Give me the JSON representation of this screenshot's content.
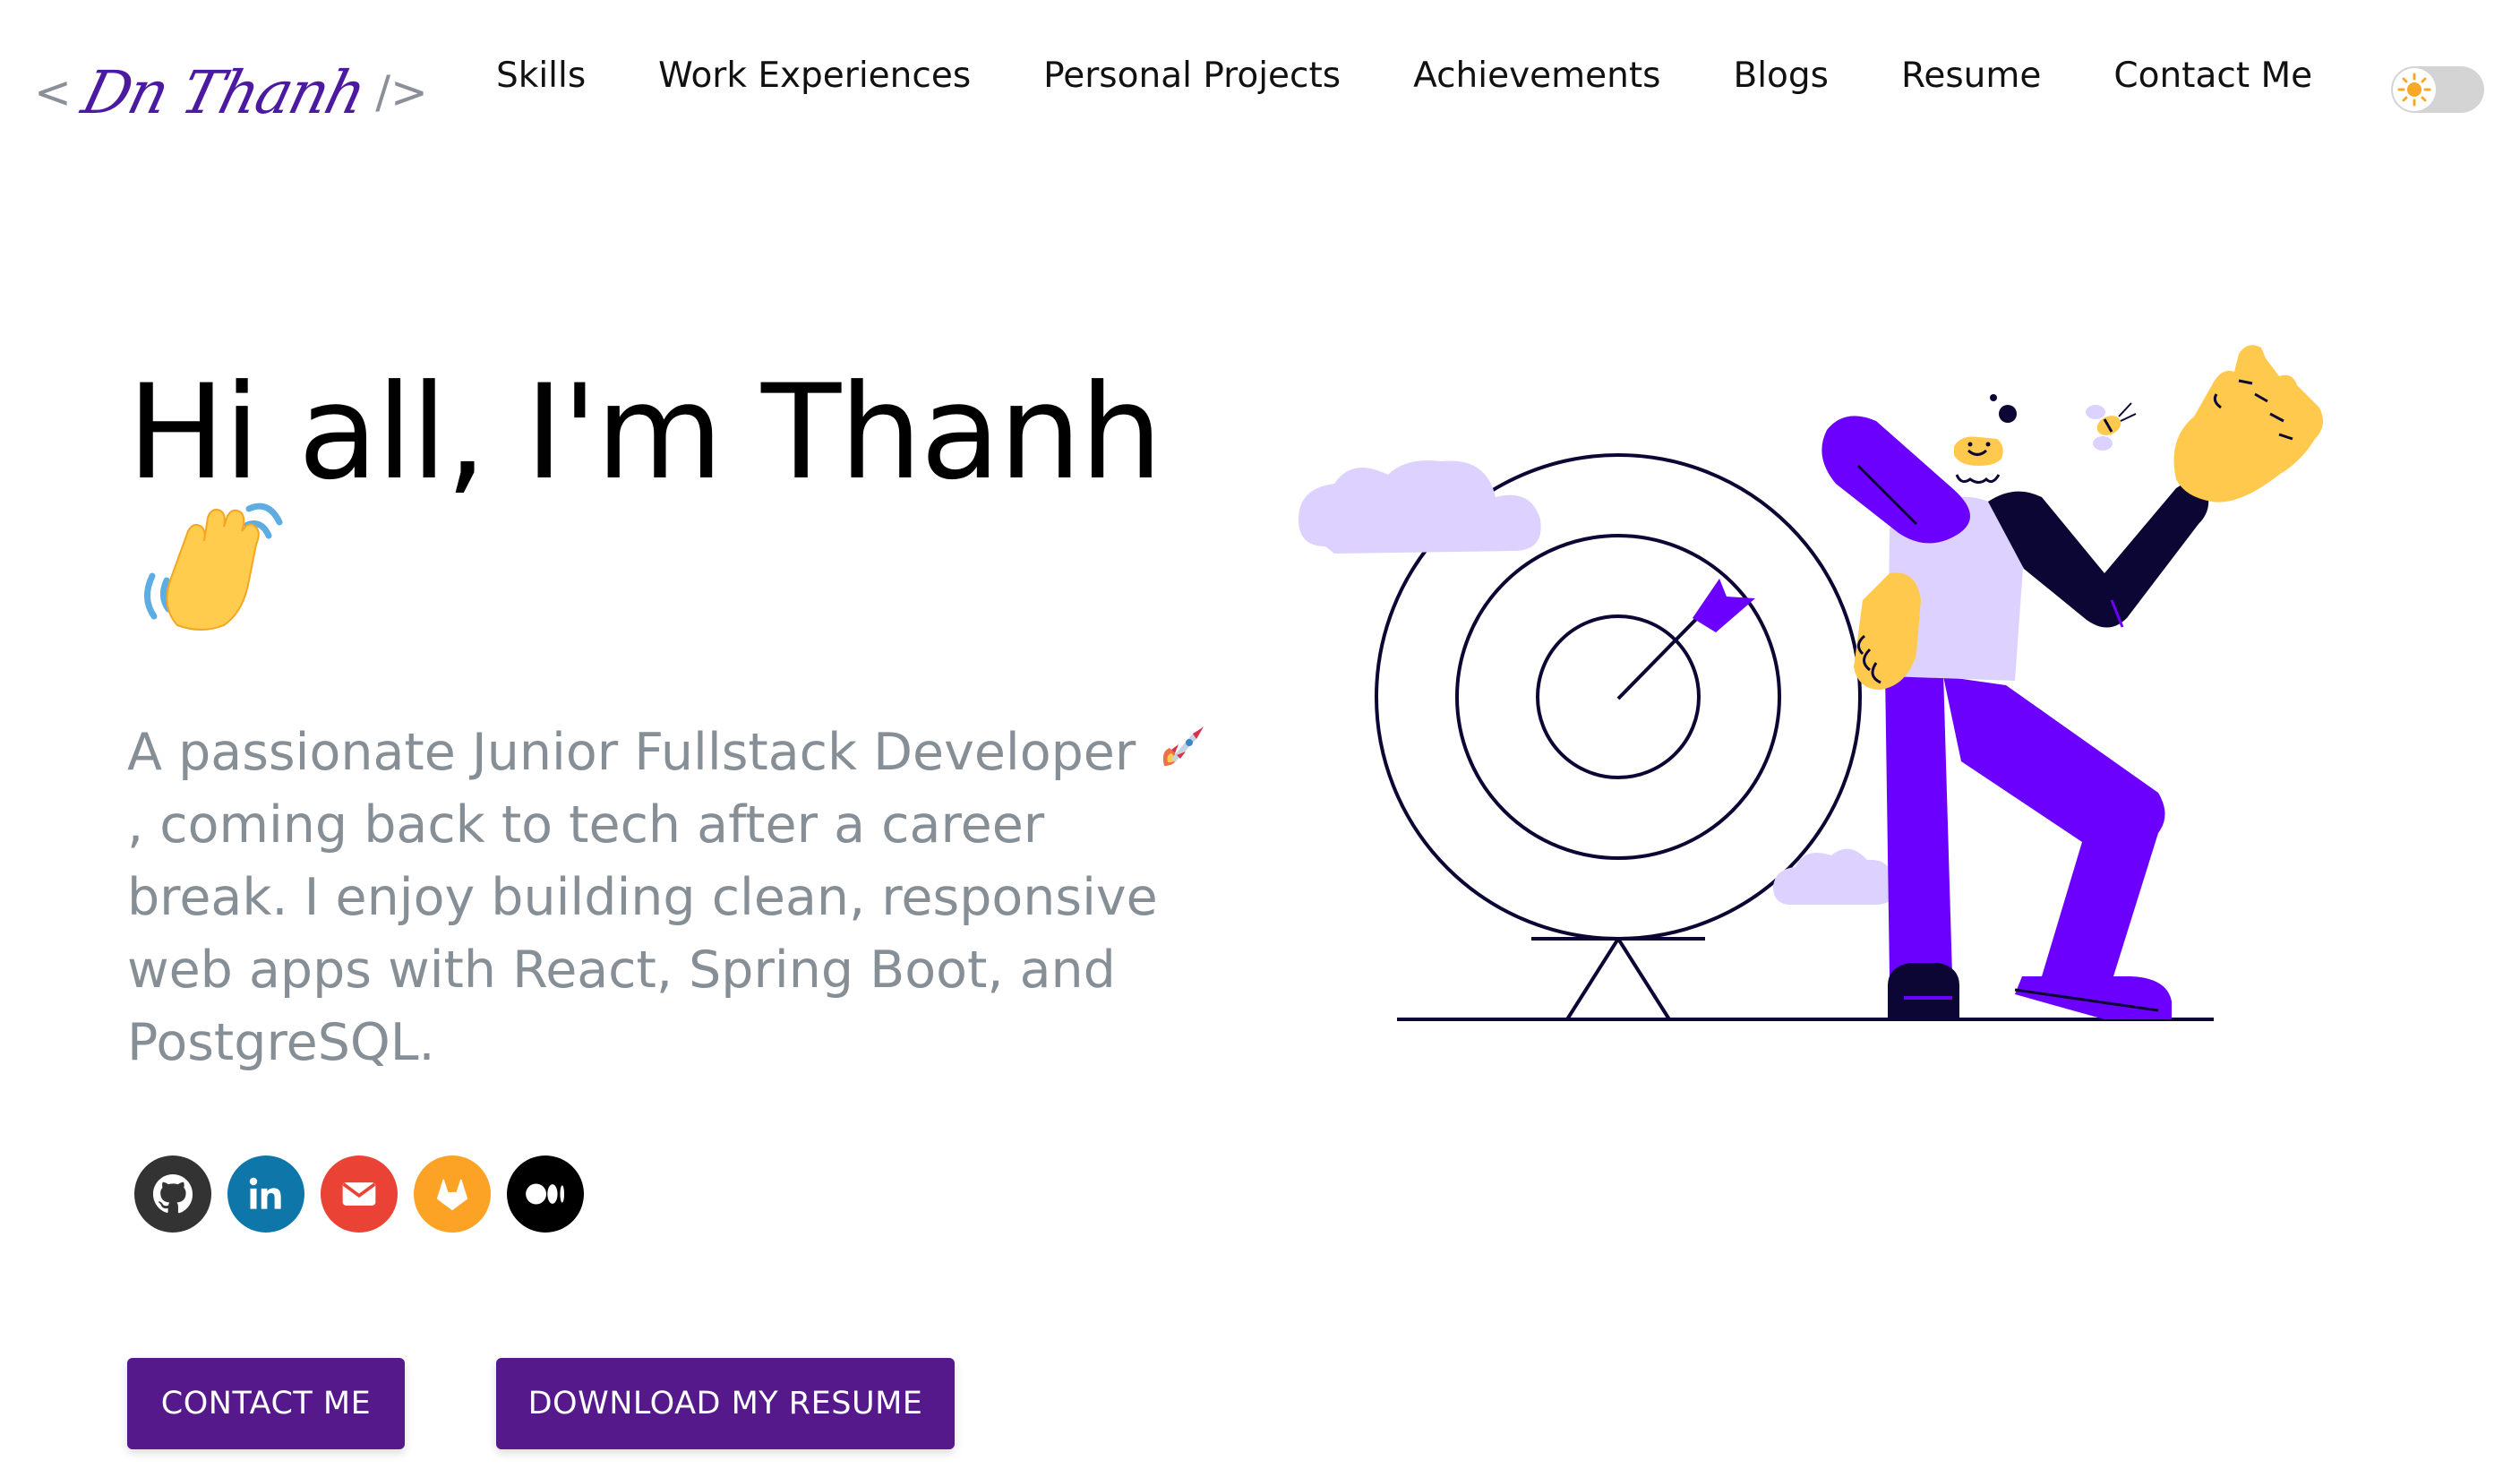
{
  "header": {
    "logo": {
      "open_bracket": "<",
      "signature": "Dn Thanh",
      "close_bracket": "/>"
    },
    "nav": [
      {
        "label": "Skills"
      },
      {
        "label": "Work Experiences"
      },
      {
        "label": "Personal Projects"
      },
      {
        "label": "Achievements"
      },
      {
        "label": "Blogs"
      },
      {
        "label": "Resume"
      },
      {
        "label": "Contact Me"
      }
    ],
    "theme_toggle": {
      "icon": "sun-icon",
      "state": "light"
    }
  },
  "hero": {
    "greeting": "Hi all, I'm Thanh",
    "greeting_emoji": "waving-hand-icon",
    "subtitle_part1": "A passionate Junior Fullstack Developer ",
    "subtitle_emoji": "rocket-icon",
    "subtitle_part2": ", coming back to tech after a career break. I enjoy building clean, responsive web apps with React, Spring Boot, and PostgreSQL.",
    "illustration": "developer-target-illustration"
  },
  "social": [
    {
      "name": "github",
      "icon": "github-icon",
      "color": "#333333"
    },
    {
      "name": "linkedin",
      "icon": "linkedin-icon",
      "color": "#0e76a8"
    },
    {
      "name": "email",
      "icon": "mail-icon",
      "color": "#ea4335"
    },
    {
      "name": "gitlab",
      "icon": "gitlab-icon",
      "color": "#fca326"
    },
    {
      "name": "medium",
      "icon": "medium-icon",
      "color": "#000000"
    }
  ],
  "buttons": {
    "contact_label": "CONTACT ME",
    "resume_label": "DOWNLOAD MY RESUME"
  },
  "colors": {
    "primary": "#55198b",
    "subtitle": "#868e96",
    "illustration_purple": "#6c00ff",
    "illustration_lilac": "#ddd2ff",
    "illustration_yellow": "#ffc94d",
    "illustration_navy": "#0c0634"
  }
}
